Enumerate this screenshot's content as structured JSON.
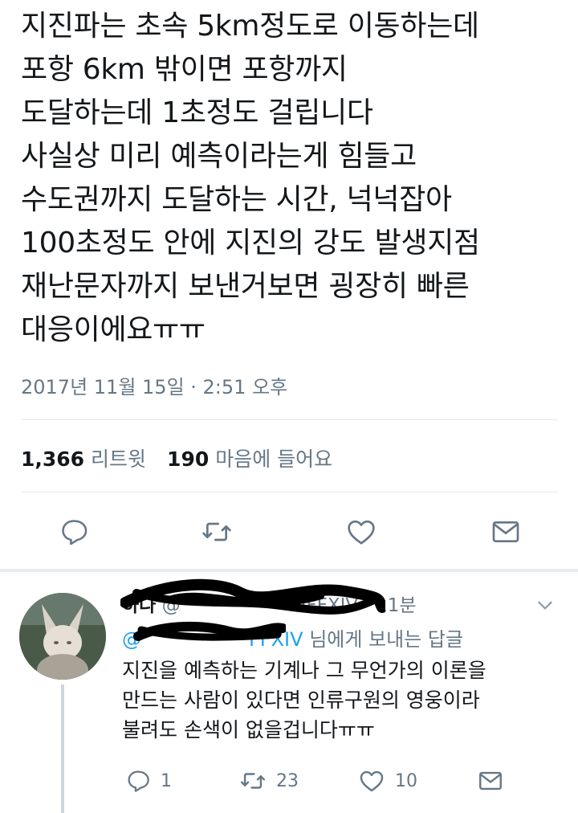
{
  "tweet": {
    "text": "지진파는 초속 5km정도로 이동하는데\n포항 6km 밖이면 포항까지\n도달하는데 1초정도 걸립니다\n사실상 미리 예측이라는게 힘들고\n수도권까지 도달하는 시간, 넉넉잡아\n100초정도 안에 지진의 강도 발생지점\n재난문자까지 보낸거보면 굉장히 빠른\n대응이에요ㅠㅠ",
    "timestamp": "2017년 11월 15일 · 2:51 오후",
    "retweet_count": "1,366",
    "retweet_label": "리트윗",
    "like_count": "190",
    "like_label": "마음에 들어요"
  },
  "actions": {
    "reply_icon": "reply-icon",
    "retweet_icon": "retweet-icon",
    "like_icon": "heart-icon",
    "dm_icon": "mail-icon"
  },
  "reply": {
    "name": "하나",
    "handle": "@",
    "handle_suffix": "IFFXIV",
    "time": "· 11분",
    "replying_mention": "@",
    "replying_mention_suffix": "FFXIV",
    "replying_label": "님에게 보내는 답글",
    "text": "지진을 예측하는 기계나 그 무언가의 이론을\n만드는 사람이 있다면 인류구원의 영웅이라\n불려도 손색이 없을겁니다ㅠㅠ",
    "reply_count": "1",
    "retweet_count": "23",
    "like_count": "10"
  },
  "colors": {
    "text": "#14171a",
    "muted": "#657786",
    "link": "#1da1f2",
    "border": "#e1e8ed"
  }
}
